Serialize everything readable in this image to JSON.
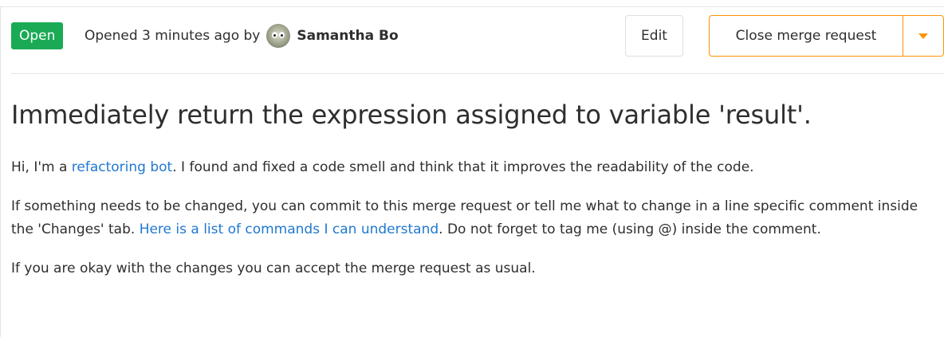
{
  "header": {
    "status": "Open",
    "opened_text": "Opened 3 minutes ago by",
    "author": "Samantha Bo",
    "edit_label": "Edit",
    "close_label": "Close merge request"
  },
  "title": "Immediately return the expression assigned to variable 'result'.",
  "description": {
    "p1_before": "Hi, I'm a ",
    "p1_link": "refactoring bot",
    "p1_after": ". I found and fixed a code smell and think that it improves the readability of the code.",
    "p2_before": "If something needs to be changed, you can commit to this merge request or tell me what to change in a line specific comment inside the 'Changes' tab. ",
    "p2_link": "Here is a list of commands I can understand",
    "p2_after": ". Do not forget to tag me (using @) inside the comment.",
    "p3": "If you are okay with the changes you can accept the merge request as usual."
  },
  "colors": {
    "status_green": "#1aaa55",
    "link_blue": "#1f78d1",
    "close_orange": "#fc9403"
  },
  "icons": {
    "dropdown": "caret-down-icon",
    "avatar": "user-avatar"
  }
}
